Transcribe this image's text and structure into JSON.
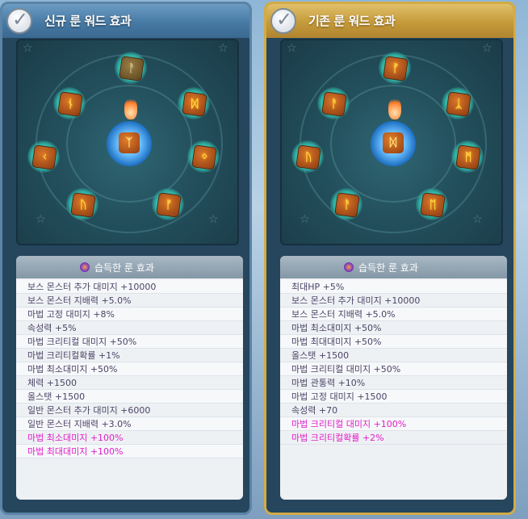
{
  "left_panel": {
    "title": "신규 룬 워드 효과",
    "list_header": "습득한 룬 효과",
    "effects": [
      {
        "text": "보스 몬스터 추가 대미지 +10000",
        "highlight": false
      },
      {
        "text": "보스 몬스터 지배력 +5.0%",
        "highlight": false
      },
      {
        "text": "마법 고정 대미지 +8%",
        "highlight": false
      },
      {
        "text": "속성력 +5%",
        "highlight": false
      },
      {
        "text": "마법 크리티컬 대미지 +50%",
        "highlight": false
      },
      {
        "text": "마법 크리티컬확률 +1%",
        "highlight": false
      },
      {
        "text": "마법 최소대미지 +50%",
        "highlight": false
      },
      {
        "text": "체력 +1500",
        "highlight": false
      },
      {
        "text": "올스탯 +1500",
        "highlight": false
      },
      {
        "text": "일반 몬스터 추가 대미지 +6000",
        "highlight": false
      },
      {
        "text": "일반 몬스터 지배력 +3.0%",
        "highlight": false
      },
      {
        "text": "마법 최소대미지 +100%",
        "highlight": true
      },
      {
        "text": "마법 최대대미지 +100%",
        "highlight": true
      }
    ]
  },
  "right_panel": {
    "title": "기존 룬 워드 효과",
    "list_header": "습득한 룬 효과",
    "effects": [
      {
        "text": "최대HP +5%",
        "highlight": false
      },
      {
        "text": "보스 몬스터 추가 대미지 +10000",
        "highlight": false
      },
      {
        "text": "보스 몬스터 지배력 +5.0%",
        "highlight": false
      },
      {
        "text": "마법 최소대미지 +50%",
        "highlight": false
      },
      {
        "text": "마법 최대대미지 +50%",
        "highlight": false
      },
      {
        "text": "올스탯 +1500",
        "highlight": false
      },
      {
        "text": "마법 크리티컬 대미지 +50%",
        "highlight": false
      },
      {
        "text": "마법 관통력 +10%",
        "highlight": false
      },
      {
        "text": "마법 고정 대미지 +1500",
        "highlight": false
      },
      {
        "text": "속성력 +70",
        "highlight": false
      },
      {
        "text": "마법 크리티컬 대미지 +100%",
        "highlight": true
      },
      {
        "text": "마법 크리티컬확률 +2%",
        "highlight": true
      }
    ]
  },
  "colors": {
    "highlight": "#e11ec9",
    "normal_text": "#4c4466",
    "new_header": "#477aa4",
    "old_header": "#c59a3a"
  },
  "icons": [
    "check-icon",
    "rune-stone-icon",
    "rune-effect-icon",
    "star-icon"
  ]
}
